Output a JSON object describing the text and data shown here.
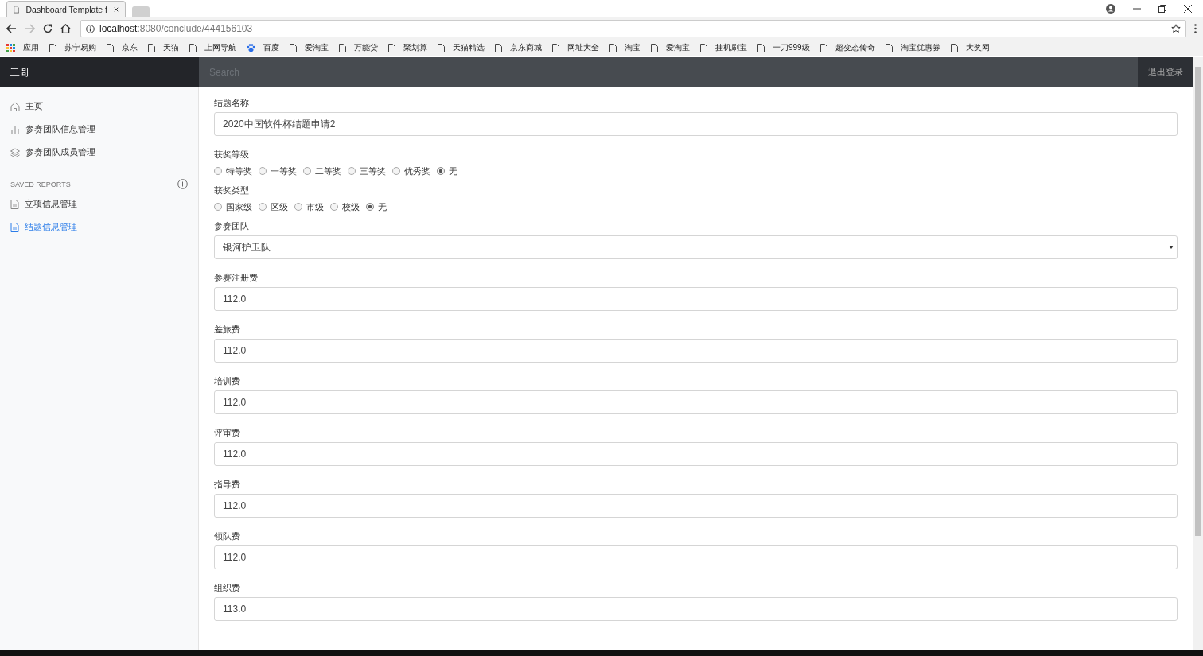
{
  "browser": {
    "tab_title": "Dashboard Template f",
    "address_host": "localhost",
    "address_path": ":8080/conclude/444156103",
    "bookmarks": [
      {
        "label": "应用",
        "kind": "apps"
      },
      {
        "label": "苏宁易购",
        "kind": "page"
      },
      {
        "label": "京东",
        "kind": "page"
      },
      {
        "label": "天猫",
        "kind": "page"
      },
      {
        "label": "上网导航",
        "kind": "page"
      },
      {
        "label": "百度",
        "kind": "paw"
      },
      {
        "label": "爱淘宝",
        "kind": "page"
      },
      {
        "label": "万能贷",
        "kind": "page"
      },
      {
        "label": "聚划算",
        "kind": "page"
      },
      {
        "label": "天猫精选",
        "kind": "page"
      },
      {
        "label": "京东商城",
        "kind": "page"
      },
      {
        "label": "网址大全",
        "kind": "page"
      },
      {
        "label": "淘宝",
        "kind": "page"
      },
      {
        "label": "爱淘宝",
        "kind": "page"
      },
      {
        "label": "挂机刷宝",
        "kind": "page"
      },
      {
        "label": "一刀999级",
        "kind": "page"
      },
      {
        "label": "超变态传奇",
        "kind": "page"
      },
      {
        "label": "淘宝优惠券",
        "kind": "page"
      },
      {
        "label": "大奖网",
        "kind": "page"
      }
    ]
  },
  "navbar": {
    "brand": "二哥",
    "search_placeholder": "Search",
    "signout": "退出登录"
  },
  "sidebar": {
    "items": [
      {
        "label": "主页",
        "kind": "home",
        "selected": false
      },
      {
        "label": "参赛团队信息管理",
        "kind": "chart",
        "selected": false
      },
      {
        "label": "参赛团队成员管理",
        "kind": "layers",
        "selected": false
      }
    ],
    "section_title": "SAVED REPORTS",
    "reports": [
      {
        "label": "立项信息管理",
        "kind": "file",
        "selected": false
      },
      {
        "label": "结题信息管理",
        "kind": "file",
        "selected": true
      }
    ]
  },
  "form": [
    {
      "kind": "text",
      "label": "结题名称",
      "value": "2020中国软件杯结题申请2"
    },
    {
      "kind": "radio",
      "label": "获奖等级",
      "options": [
        {
          "label": "特等奖",
          "selected": false
        },
        {
          "label": "一等奖",
          "selected": false
        },
        {
          "label": "二等奖",
          "selected": false
        },
        {
          "label": "三等奖",
          "selected": false
        },
        {
          "label": "优秀奖",
          "selected": false
        },
        {
          "label": "无",
          "selected": true
        }
      ]
    },
    {
      "kind": "radio",
      "label": "获奖类型",
      "options": [
        {
          "label": "国家级",
          "selected": false
        },
        {
          "label": "区级",
          "selected": false
        },
        {
          "label": "市级",
          "selected": false
        },
        {
          "label": "校级",
          "selected": false
        },
        {
          "label": "无",
          "selected": true
        }
      ]
    },
    {
      "kind": "select",
      "label": "参赛团队",
      "value": "银河护卫队"
    },
    {
      "kind": "text",
      "label": "参赛注册费",
      "value": "112.0"
    },
    {
      "kind": "text",
      "label": "差旅费",
      "value": "112.0"
    },
    {
      "kind": "text",
      "label": "培训费",
      "value": "112.0"
    },
    {
      "kind": "text",
      "label": "评审费",
      "value": "112.0"
    },
    {
      "kind": "text",
      "label": "指导费",
      "value": "112.0"
    },
    {
      "kind": "text",
      "label": "领队费",
      "value": "112.0"
    },
    {
      "kind": "text",
      "label": "组织费",
      "value": "113.0"
    }
  ]
}
